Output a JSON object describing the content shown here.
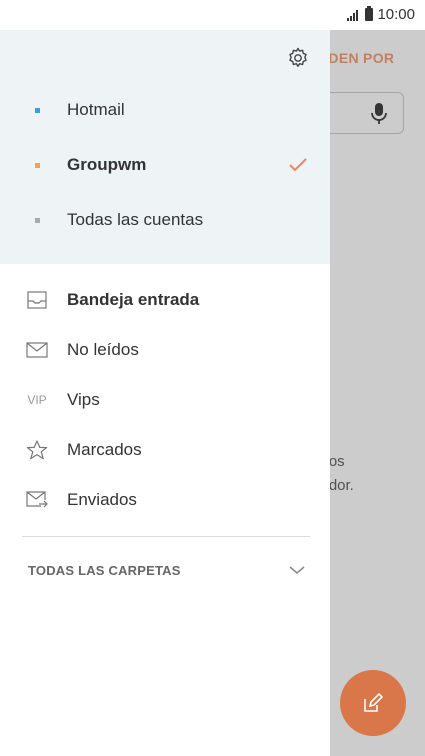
{
  "status_bar": {
    "time": "10:00"
  },
  "background": {
    "sort_label": "RDEN POR",
    "empty_text_line1": "icos",
    "empty_text_line2": "vidor."
  },
  "drawer": {
    "accounts": [
      {
        "name": "Hotmail",
        "color": "#3a9ee6",
        "selected": false
      },
      {
        "name": "Groupwm",
        "color": "#f0a34a",
        "selected": true
      },
      {
        "name": "Todas las cuentas",
        "color": "#aaaaaa",
        "selected": false
      }
    ],
    "folders": [
      {
        "label": "Bandeja entrada",
        "icon": "inbox-icon",
        "bold": true
      },
      {
        "label": "No leídos",
        "icon": "envelope-icon",
        "bold": false
      },
      {
        "label": "Vips",
        "icon": "vip-icon",
        "icon_text": "VIP",
        "bold": false
      },
      {
        "label": "Marcados",
        "icon": "star-icon",
        "bold": false
      },
      {
        "label": "Enviados",
        "icon": "sent-icon",
        "bold": false
      }
    ],
    "all_folders_label": "TODAS LAS CARPETAS"
  },
  "colors": {
    "accent": "#f0845c",
    "fab": "#d9764a",
    "accounts_bg": "#eef3f5"
  }
}
